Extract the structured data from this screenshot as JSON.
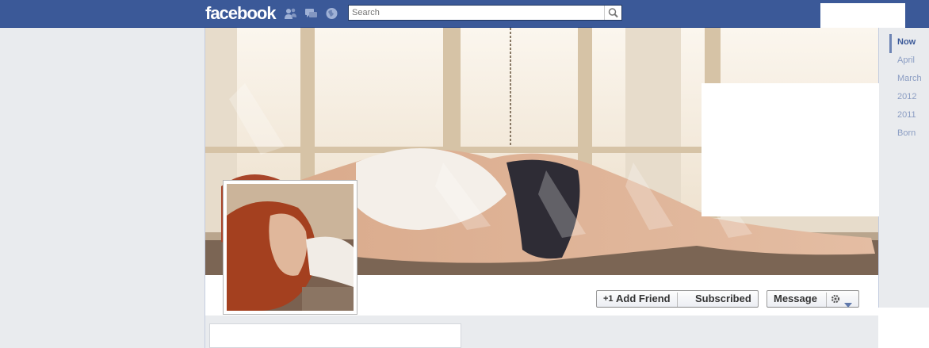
{
  "header": {
    "logo": "facebook",
    "search": {
      "placeholder": "Search",
      "value": "Search"
    },
    "icons": [
      "friend-requests-icon",
      "messages-icon",
      "notifications-icon",
      "search-icon"
    ]
  },
  "actions": {
    "add_friend": "Add Friend",
    "add_friend_prefix": "+1",
    "subscribed": "Subscribed",
    "message": "Message",
    "settings_icon": "gear-icon",
    "dropdown_icon": "chevron-down-icon"
  },
  "timeline": {
    "items": [
      {
        "label": "Now",
        "active": true
      },
      {
        "label": "April",
        "active": false
      },
      {
        "label": "March",
        "active": false
      },
      {
        "label": "2012",
        "active": false
      },
      {
        "label": "2011",
        "active": false
      },
      {
        "label": "Born",
        "active": false
      }
    ]
  },
  "colors": {
    "brand": "#3b5998",
    "page_bg": "#e9ebee",
    "timeline_active": "#3b5998",
    "timeline_inactive": "#8b9dc3"
  }
}
